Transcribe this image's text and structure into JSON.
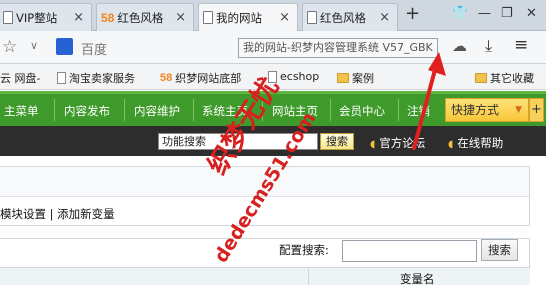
{
  "tabs": [
    {
      "favicon": "document-icon",
      "label": "VIP整站",
      "active": false
    },
    {
      "favicon": "58-icon",
      "favicon_text": "58",
      "label": "红色风格",
      "active": false
    },
    {
      "favicon": "document-icon",
      "label": "我的网站",
      "active": true
    },
    {
      "favicon": "document-icon",
      "label": "红色风格",
      "active": false
    }
  ],
  "tab_close_glyph": "×",
  "new_tab_glyph": "+",
  "address_bar": {
    "search_engine_icon": "baidu-paw-icon",
    "search_engine_label": "百度",
    "tooltip_text": "我的网站-织梦内容管理系统 V57_GBK"
  },
  "bookmarks": [
    {
      "icon": "none",
      "label": "云 网盘-"
    },
    {
      "icon": "document-icon",
      "label": "淘宝卖家服务"
    },
    {
      "icon": "58-icon",
      "icon_text": "58",
      "label": "织梦网站底部"
    },
    {
      "icon": "document-icon",
      "label": "ecshop"
    },
    {
      "icon": "folder-icon",
      "label": "案例"
    },
    {
      "icon": "folder-icon",
      "label": "其它收藏"
    }
  ],
  "nav": {
    "items": [
      "主菜单",
      "内容发布",
      "内容维护",
      "系统主页",
      "网站主页",
      "会员中心",
      "注销"
    ],
    "shortcut_label": "快捷方式",
    "plus_label": "+"
  },
  "toolbar": {
    "search_value": "功能搜索",
    "search_button": "搜索",
    "links": [
      "官方论坛",
      "在线帮助"
    ]
  },
  "content": {
    "breadcrumb": "模块设置 | 添加新变量",
    "config_search_label": "配置搜索:",
    "config_search_value": "",
    "config_search_button": "搜索",
    "table_header": "变量名"
  },
  "watermark": {
    "text_cn": "织梦无忧",
    "text_url": "dedecms51.com"
  },
  "colors": {
    "nav_green": "#3e9a2a",
    "dark_bar": "#2d2d2d",
    "accent_yellow": "#f8c53a",
    "watermark_red": "#d92020"
  }
}
